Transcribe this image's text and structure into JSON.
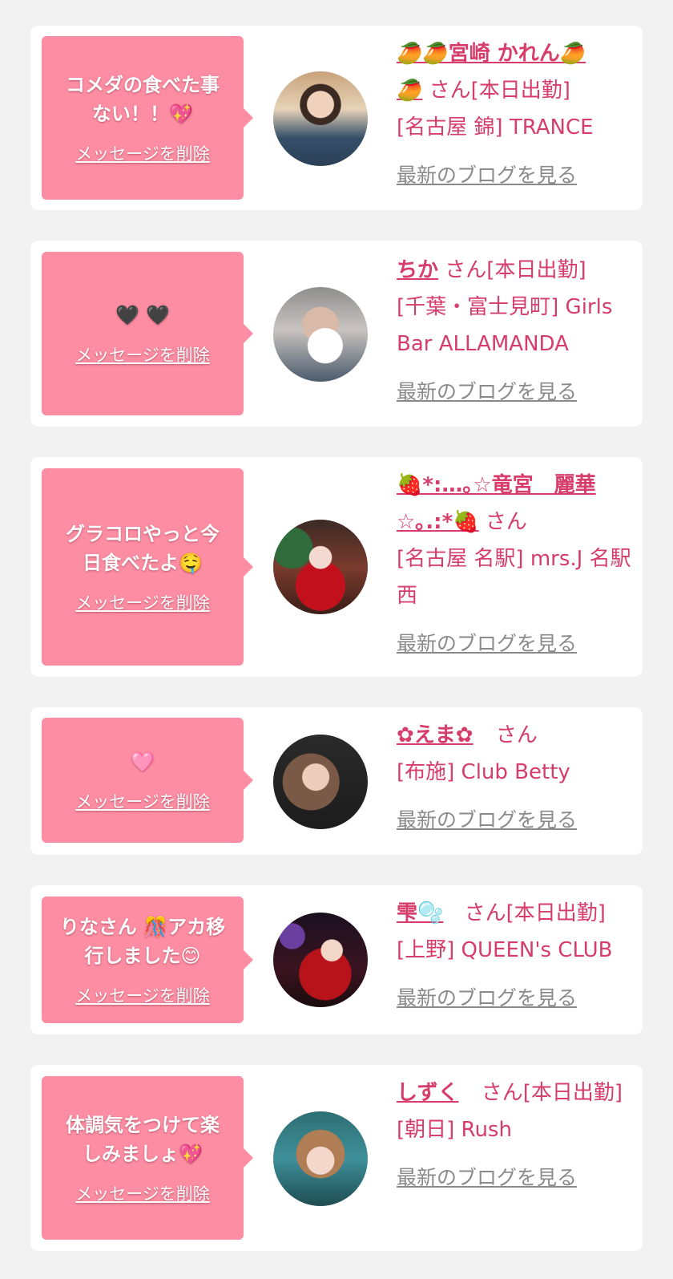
{
  "delete_label": "メッセージを削除",
  "san_label": "さん",
  "blog_label": "最新のブログを見る",
  "cards": [
    {
      "message": "コメダの食べた事\nない！！💖",
      "name": "🥭🥭宮崎 かれん🥭\n🥭",
      "suffix": "[本日出勤]",
      "store": "[名古屋 錦] TRANCE"
    },
    {
      "message": "🖤 🖤",
      "name": "ちか",
      "suffix": "[本日出勤]",
      "store": "[千葉・富士見町] Girls Bar ALLAMANDA"
    },
    {
      "message": "グラコロやっと今\n日食べたよ🤤",
      "name": "🍓*:…｡☆竜宮　麗華\n☆｡.:*🍓",
      "suffix": "",
      "store": "[名古屋 名駅] mrs.J 名駅西"
    },
    {
      "message": "🩷",
      "name": "✿えま✿",
      "suffix": "",
      "store": "[布施] Club Betty"
    },
    {
      "message": "りなさん 🎊アカ移\n行しました😊",
      "name": "雫🫧",
      "suffix": "[本日出勤]",
      "store": "[上野] QUEEN's CLUB"
    },
    {
      "message": "体調気をつけて楽\nしみましょ💖",
      "name": "しずく",
      "suffix": "[本日出勤]",
      "store": "[朝日] Rush"
    }
  ],
  "colors": {
    "page_bg": "#f2f2f2",
    "card_bg": "#ffffff",
    "bubble_bg": "#fd8da2",
    "accent": "#d63d6b",
    "link_gray": "#8a8a8a"
  }
}
